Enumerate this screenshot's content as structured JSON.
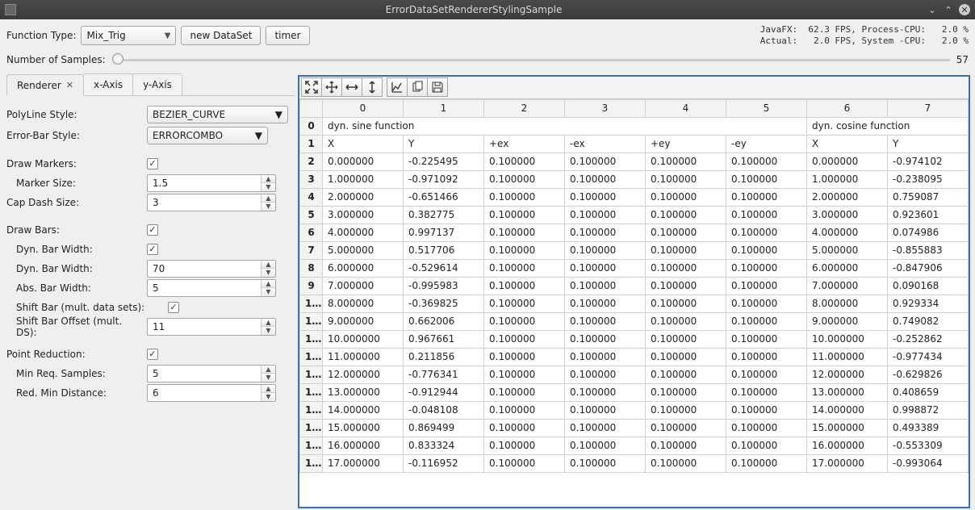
{
  "window": {
    "title": "ErrorDataSetRendererStylingSample"
  },
  "toolbar_top": {
    "func_type_label": "Function Type:",
    "func_type_value": "Mix_Trig",
    "new_dataset_btn": "new DataSet",
    "timer_btn": "timer",
    "stats_line1": "JavaFX:  62.3 FPS, Process-CPU:   2.0 %",
    "stats_line2": "Actual:   2.0 FPS, System -CPU:   2.0 %"
  },
  "slider": {
    "label": "Number of Samples:",
    "max_label": "57"
  },
  "tabs": {
    "items": [
      {
        "label": "Renderer",
        "closable": true,
        "active": true
      },
      {
        "label": "x-Axis",
        "closable": false,
        "active": false
      },
      {
        "label": "y-Axis",
        "closable": false,
        "active": false
      }
    ]
  },
  "form": {
    "polyline_label": "PolyLine Style:",
    "polyline_value": "BEZIER_CURVE",
    "errorbar_label": "Error-Bar Style:",
    "errorbar_value": "ERRORCOMBO",
    "drawmarkers_label": "Draw Markers:",
    "drawmarkers_checked": "✓",
    "markersize_label": "Marker Size:",
    "markersize_value": "1.5",
    "capdash_label": "Cap Dash Size:",
    "capdash_value": "3",
    "drawbars_label": "Draw Bars:",
    "drawbars_checked": "✓",
    "dynbarw_chk_label": "Dyn. Bar Width:",
    "dynbarw_chk_checked": "✓",
    "dynbarw_label": "Dyn. Bar Width:",
    "dynbarw_value": "70",
    "absbarw_label": "Abs. Bar Width:",
    "absbarw_value": "5",
    "shiftbar_label": "Shift Bar (mult. data sets):",
    "shiftbar_checked": "✓",
    "shiftbaroff_label": "Shift Bar Offset (mult. DS):",
    "shiftbaroff_value": "11",
    "pointred_label": "Point Reduction:",
    "pointred_checked": "✓",
    "minreq_label": "Min Req. Samples:",
    "minreq_value": "5",
    "redmin_label": "Red. Min Distance:",
    "redmin_value": "6"
  },
  "table": {
    "col_headers": [
      "0",
      "1",
      "2",
      "3",
      "4",
      "5",
      "6",
      "7"
    ],
    "row0": {
      "ds1": "dyn. sine function",
      "ds2": "dyn. cosine function"
    },
    "row1": [
      "X",
      "Y",
      "+ex",
      "-ex",
      "+ey",
      "-ey",
      "X",
      "Y"
    ],
    "rows": [
      [
        "0.000000",
        "-0.225495",
        "0.100000",
        "0.100000",
        "0.100000",
        "0.100000",
        "0.000000",
        "-0.974102"
      ],
      [
        "1.000000",
        "-0.971092",
        "0.100000",
        "0.100000",
        "0.100000",
        "0.100000",
        "1.000000",
        "-0.238095"
      ],
      [
        "2.000000",
        "-0.651466",
        "0.100000",
        "0.100000",
        "0.100000",
        "0.100000",
        "2.000000",
        "0.759087"
      ],
      [
        "3.000000",
        "0.382775",
        "0.100000",
        "0.100000",
        "0.100000",
        "0.100000",
        "3.000000",
        "0.923601"
      ],
      [
        "4.000000",
        "0.997137",
        "0.100000",
        "0.100000",
        "0.100000",
        "0.100000",
        "4.000000",
        "0.074986"
      ],
      [
        "5.000000",
        "0.517706",
        "0.100000",
        "0.100000",
        "0.100000",
        "0.100000",
        "5.000000",
        "-0.855883"
      ],
      [
        "6.000000",
        "-0.529614",
        "0.100000",
        "0.100000",
        "0.100000",
        "0.100000",
        "6.000000",
        "-0.847906"
      ],
      [
        "7.000000",
        "-0.995983",
        "0.100000",
        "0.100000",
        "0.100000",
        "0.100000",
        "7.000000",
        "0.090168"
      ],
      [
        "8.000000",
        "-0.369825",
        "0.100000",
        "0.100000",
        "0.100000",
        "0.100000",
        "8.000000",
        "0.929334"
      ],
      [
        "9.000000",
        "0.662006",
        "0.100000",
        "0.100000",
        "0.100000",
        "0.100000",
        "9.000000",
        "0.749082"
      ],
      [
        "10.000000",
        "0.967661",
        "0.100000",
        "0.100000",
        "0.100000",
        "0.100000",
        "10.000000",
        "-0.252862"
      ],
      [
        "11.000000",
        "0.211856",
        "0.100000",
        "0.100000",
        "0.100000",
        "0.100000",
        "11.000000",
        "-0.977434"
      ],
      [
        "12.000000",
        "-0.776341",
        "0.100000",
        "0.100000",
        "0.100000",
        "0.100000",
        "12.000000",
        "-0.629826"
      ],
      [
        "13.000000",
        "-0.912944",
        "0.100000",
        "0.100000",
        "0.100000",
        "0.100000",
        "13.000000",
        "0.408659"
      ],
      [
        "14.000000",
        "-0.048108",
        "0.100000",
        "0.100000",
        "0.100000",
        "0.100000",
        "14.000000",
        "0.998872"
      ],
      [
        "15.000000",
        "0.869499",
        "0.100000",
        "0.100000",
        "0.100000",
        "0.100000",
        "15.000000",
        "0.493389"
      ],
      [
        "16.000000",
        "0.833324",
        "0.100000",
        "0.100000",
        "0.100000",
        "0.100000",
        "16.000000",
        "-0.553309"
      ],
      [
        "17.000000",
        "-0.116952",
        "0.100000",
        "0.100000",
        "0.100000",
        "0.100000",
        "17.000000",
        "-0.993064"
      ]
    ]
  }
}
